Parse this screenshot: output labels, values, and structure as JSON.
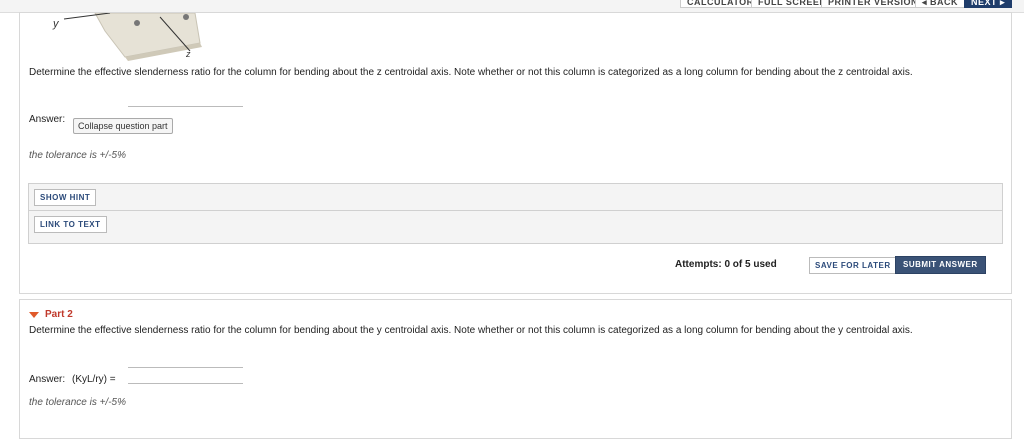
{
  "toolbar": {
    "calculator": "CALCULATOR",
    "full_screen": "FULL SCREEN",
    "printer_version": "PRINTER VERSION",
    "back": "◂ BACK",
    "next": "NEXT ▸"
  },
  "diagram": {
    "y_label": "y",
    "z_label": "z"
  },
  "part1": {
    "question": "Determine the effective slenderness ratio for the column for bending about the z centroidal axis.  Note whether or not this column is categorized as a long column for bending about the z centroidal axis.",
    "answer_label": "Answer:",
    "tooltip": "Collapse question part",
    "tolerance": "the tolerance is +/-5%",
    "show_hint": "SHOW HINT",
    "link_to_text": "LINK TO TEXT",
    "attempts": "Attempts: 0 of 5 used",
    "save_for_later": "SAVE FOR LATER",
    "submit_answer": "SUBMIT ANSWER"
  },
  "part2": {
    "title": "Part 2",
    "question": "Determine the effective slenderness ratio for the column for bending about the y centroidal axis. Note whether or not this column is categorized as a long column for bending about the y centroidal axis.",
    "answer_label": "Answer:",
    "answer_expr": "(KyL/ry) =",
    "tolerance": "the tolerance is +/-5%"
  },
  "colors": {
    "submit_bg": "#3a5276",
    "part_title": "#c0392b",
    "next_bg": "#1f3d6b"
  }
}
